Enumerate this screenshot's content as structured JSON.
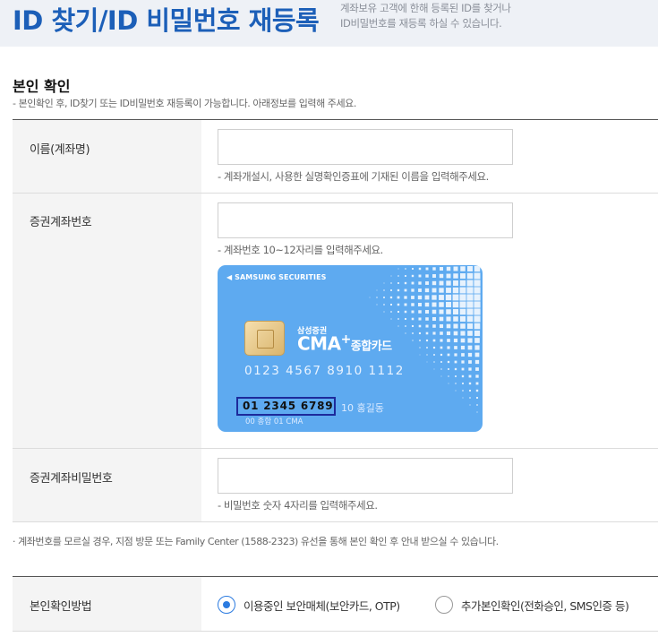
{
  "header": {
    "title": "ID 찾기/ID 비밀번호 재등록",
    "desc_line1": "계좌보유 고객에 한해 등록된 ID를 찾거나",
    "desc_line2": "ID비밀번호를 재등록 하실 수 있습니다."
  },
  "section": {
    "title": "본인 확인",
    "desc": "- 본인확인 후, ID찾기 또는 ID비밀번호 재등록이 가능합니다. 아래정보를 입력해 주세요."
  },
  "fields": {
    "name": {
      "label": "이름(계좌명)",
      "value": "",
      "hint": "- 계좌개설시, 사용한 실명확인증표에 기재된 이름을 입력해주세요."
    },
    "account": {
      "label": "증권계좌번호",
      "value": "",
      "hint": "- 계좌번호 10~12자리를 입력해주세요."
    },
    "password": {
      "label": "증권계좌비밀번호",
      "value": "",
      "hint": "- 비밀번호 숫자 4자리를 입력해주세요."
    }
  },
  "card": {
    "brand": "◀ SAMSUNG SECURITIES",
    "logo_small": "삼성증권",
    "logo_main": "CMA",
    "logo_plus": "+",
    "logo_sub": "종합카드",
    "card_number": "0123  4567  8910  1112",
    "account_number": "01  2345  6789",
    "account_extra": "10  홍길동",
    "account_sub": "00 종합 01 CMA",
    "colors": {
      "background": "#5eaaf0",
      "highlight_box": "#1d2a9c"
    }
  },
  "notice": "· 계좌번호를 모르실 경우, 지점 방문 또는 Family Center (1588-2323) 유선을 통해 본인 확인 후 안내 받으실 수 있습니다.",
  "verification": {
    "label": "본인확인방법",
    "options": [
      {
        "label": "이용중인 보안매체(보안카드, OTP)",
        "selected": true
      },
      {
        "label": "추가본인확인(전화승인, SMS인증 등)",
        "selected": false
      }
    ]
  },
  "colors": {
    "title": "#1c5fb8",
    "header_bg": "#eef1f6",
    "radio_accent": "#2c7be0"
  }
}
